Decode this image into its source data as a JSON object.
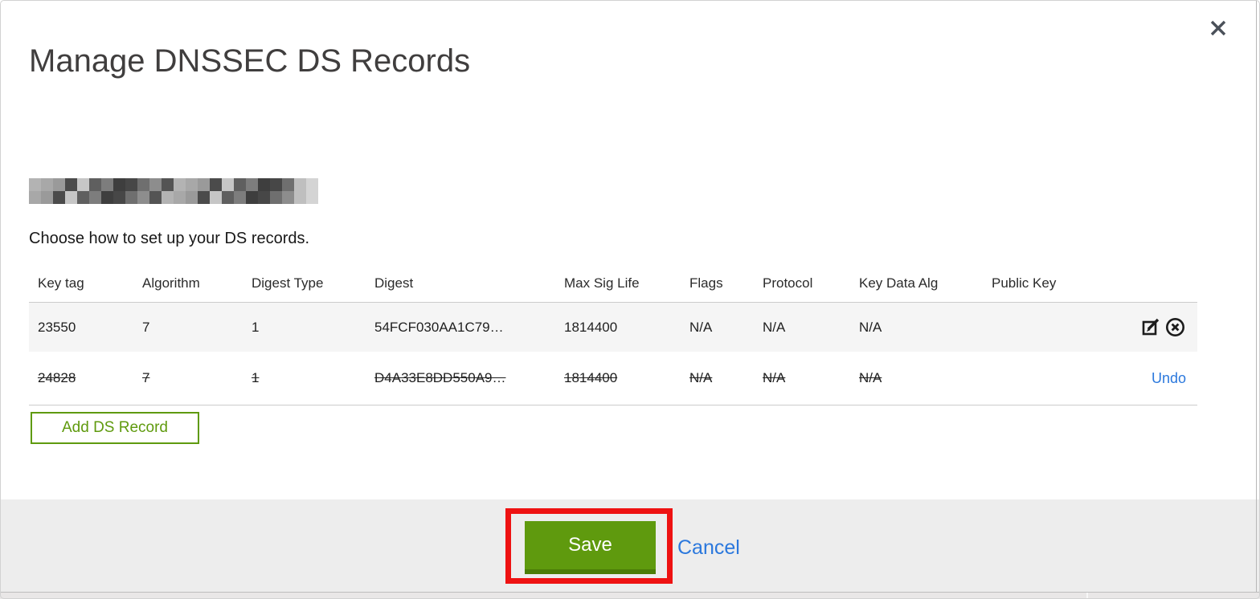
{
  "header": {
    "title": "Manage DNSSEC DS Records"
  },
  "subtitle": "Choose how to set up your DS records.",
  "table": {
    "headers": [
      "Key tag",
      "Algorithm",
      "Digest Type",
      "Digest",
      "Max Sig Life",
      "Flags",
      "Protocol",
      "Key Data Alg",
      "Public Key"
    ],
    "rows": [
      {
        "key_tag": "23550",
        "algorithm": "7",
        "digest_type": "1",
        "digest": "54FCF030AA1C79…",
        "max_sig_life": "1814400",
        "flags": "N/A",
        "protocol": "N/A",
        "key_data_alg": "N/A",
        "public_key": "",
        "state": "current"
      },
      {
        "key_tag": "24828",
        "algorithm": "7",
        "digest_type": "1",
        "digest": "D4A33E8DD550A9…",
        "max_sig_life": "1814400",
        "flags": "N/A",
        "protocol": "N/A",
        "key_data_alg": "N/A",
        "public_key": "",
        "state": "deleted",
        "undo_label": "Undo"
      }
    ]
  },
  "actions": {
    "add_label": "Add DS Record"
  },
  "footer": {
    "save_label": "Save",
    "cancel_label": "Cancel"
  },
  "icons": {
    "close": "close-icon",
    "edit": "edit-record-icon",
    "delete": "delete-record-icon"
  },
  "colors": {
    "accent_green": "#5f9a0e",
    "accent_green_dark": "#4c7d08",
    "link_blue": "#2b78dd",
    "annotation_red": "#ee1212",
    "row_highlight": "#f5f5f5"
  }
}
